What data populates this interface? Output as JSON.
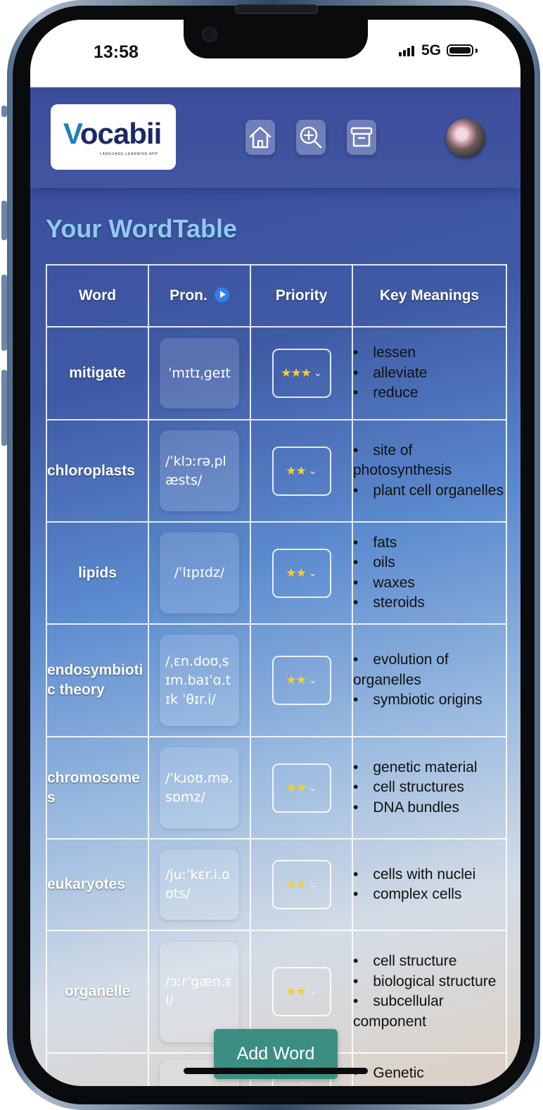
{
  "status_bar": {
    "time": "13:58",
    "network": "5G"
  },
  "header": {
    "logo_text": "vocabii",
    "logo_tagline": "LANGUAGE LEARNING APP",
    "nav": [
      "home-icon",
      "search-plus-icon",
      "archive-icon"
    ]
  },
  "page": {
    "title": "Your WordTable"
  },
  "table": {
    "headers": {
      "word": "Word",
      "pron": "Pron.",
      "priority": "Priority",
      "meanings": "Key Meanings"
    },
    "rows": [
      {
        "word": "mitigate",
        "pron": "ˈmɪtɪˌɡeɪt",
        "stars": "★★★",
        "meanings": [
          "lessen",
          "alleviate",
          "reduce"
        ]
      },
      {
        "word": "chloroplasts",
        "pron": "/ˈklɔːrəˌplæsts/",
        "stars": "★★",
        "meanings": [
          "site of photosynthesis",
          "plant cell organelles"
        ]
      },
      {
        "word": "lipids",
        "pron": "/ˈlɪpɪdz/",
        "stars": "★★",
        "meanings": [
          "fats",
          "oils",
          "waxes",
          "steroids"
        ]
      },
      {
        "word": "endosymbiotic theory",
        "pron": "/ˌɛn.doʊˌsɪm.baɪˈɑ.tɪk ˈθɪr.i/",
        "stars": "★★",
        "meanings": [
          "evolution of organelles",
          "symbiotic origins"
        ]
      },
      {
        "word": "chromosomes",
        "pron": "/ˈkɹoʊ.mə.sɒmz/",
        "stars": "★★",
        "meanings": [
          "genetic material",
          "cell structures",
          "DNA bundles"
        ]
      },
      {
        "word": "eukaryotes",
        "pron": "/juːˈkɛr.i.oʊts/",
        "stars": "★★",
        "meanings": [
          "cells with nuclei",
          "complex cells"
        ]
      },
      {
        "word": "organelle",
        "pron": "/ɔːrˈɡæn.ɛl/",
        "stars": "★★",
        "meanings": [
          "cell structure",
          "biological structure",
          "subcellular component"
        ]
      },
      {
        "word": "",
        "pron": "",
        "stars": "",
        "meanings": [
          "Genetic"
        ]
      }
    ]
  },
  "add_word_label": "Add Word"
}
